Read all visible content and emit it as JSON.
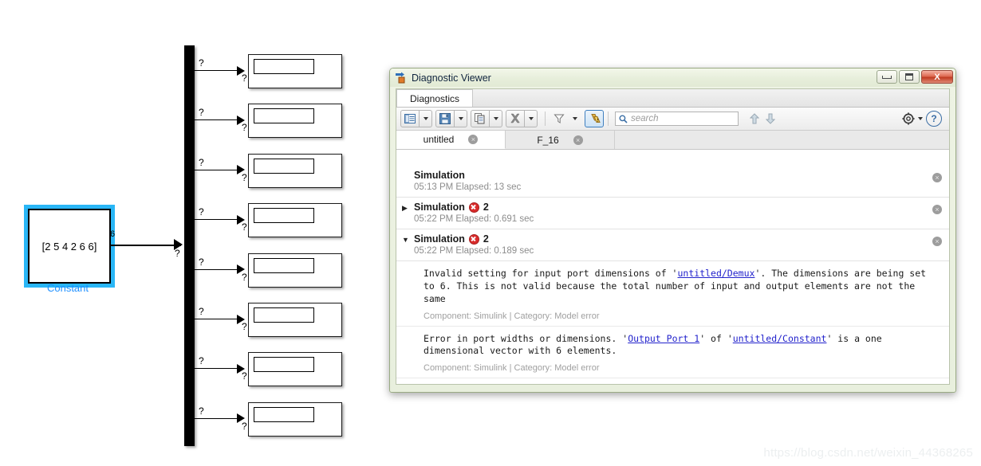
{
  "model": {
    "constant_block": {
      "value": "[2 5 4 2 6 6]",
      "label": "Constant",
      "output_signal_width": "6",
      "output_port_marker": "?"
    },
    "demux": {
      "name": "Demux",
      "port_marker": "?",
      "outputs": [
        {
          "src_marker": "?",
          "dst_marker": "?"
        },
        {
          "src_marker": "?",
          "dst_marker": "?"
        },
        {
          "src_marker": "?",
          "dst_marker": "?"
        },
        {
          "src_marker": "?",
          "dst_marker": "?"
        },
        {
          "src_marker": "?",
          "dst_marker": "?"
        },
        {
          "src_marker": "?",
          "dst_marker": "?"
        },
        {
          "src_marker": "?",
          "dst_marker": "?"
        },
        {
          "src_marker": "?",
          "dst_marker": "?"
        }
      ]
    },
    "display_blocks": [
      {
        "value": ""
      },
      {
        "value": ""
      },
      {
        "value": ""
      },
      {
        "value": ""
      },
      {
        "value": ""
      },
      {
        "value": ""
      },
      {
        "value": ""
      },
      {
        "value": ""
      }
    ],
    "watermark": "https://blog.csdn.net/weixin_44368265"
  },
  "window": {
    "title": "Diagnostic Viewer",
    "app_icon": "simulink-icon",
    "buttons": {
      "minimize": "minimize-button",
      "maximize": "maximize-button",
      "close_label": "X"
    }
  },
  "doc_tabs": [
    {
      "label": "Diagnostics",
      "active": true
    }
  ],
  "toolbar": {
    "items": [
      {
        "name": "view-layout-button",
        "icon": "list-view-icon",
        "split": true
      },
      {
        "name": "save-button",
        "icon": "save-icon",
        "split": true
      },
      {
        "name": "copy-button",
        "icon": "copy-icon",
        "split": true
      },
      {
        "name": "clear-button",
        "icon": "clear-x-icon",
        "split": true
      },
      {
        "name": "filter-button",
        "icon": "funnel-icon",
        "split": true
      },
      {
        "name": "warnings-toggle",
        "icon": "warning-icon",
        "selected": true
      }
    ],
    "search": {
      "placeholder": "search",
      "value": ""
    },
    "nav_up": "▲",
    "nav_down": "▼",
    "settings_icon": "gear-icon",
    "help_label": "?"
  },
  "source_tabs": [
    {
      "label": "untitled",
      "active": true,
      "close": "×"
    },
    {
      "label": "F_16",
      "active": false,
      "close": "×"
    }
  ],
  "messages": [
    {
      "title": "Simulation",
      "time": "05:13 PM",
      "elapsed": "Elapsed: 13 sec",
      "error_count": "",
      "expander": "",
      "expanded": false,
      "close": "×"
    },
    {
      "title": "Simulation",
      "time": "05:22 PM",
      "elapsed": "Elapsed: 0.691 sec",
      "error_count": "2",
      "expander": "▶",
      "expanded": false,
      "close": "×"
    },
    {
      "title": "Simulation",
      "time": "05:22 PM",
      "elapsed": "Elapsed: 0.189 sec",
      "error_count": "2",
      "expander": "▼",
      "expanded": true,
      "close": "×"
    }
  ],
  "details": [
    {
      "text_before": "Invalid setting for input port dimensions of '",
      "link": "untitled/Demux",
      "text_after": "'. The dimensions are being set to 6. This is not valid because the total number of input and output elements are not the same",
      "meta": "Component: Simulink | Category: Model error"
    },
    {
      "text_before": "Error in port widths or dimensions. '",
      "link": "Output Port 1",
      "text_mid": "' of '",
      "link2": "untitled/Constant",
      "text_after": "' is a one dimensional vector with 6 elements.",
      "meta": "Component: Simulink | Category: Model error"
    }
  ],
  "colors": {
    "selection": "#29b6f6",
    "block_label": "#1e90ff",
    "error_red": "#d92b2b",
    "link_blue": "#2222cc",
    "window_chrome": "#e8efdd"
  }
}
